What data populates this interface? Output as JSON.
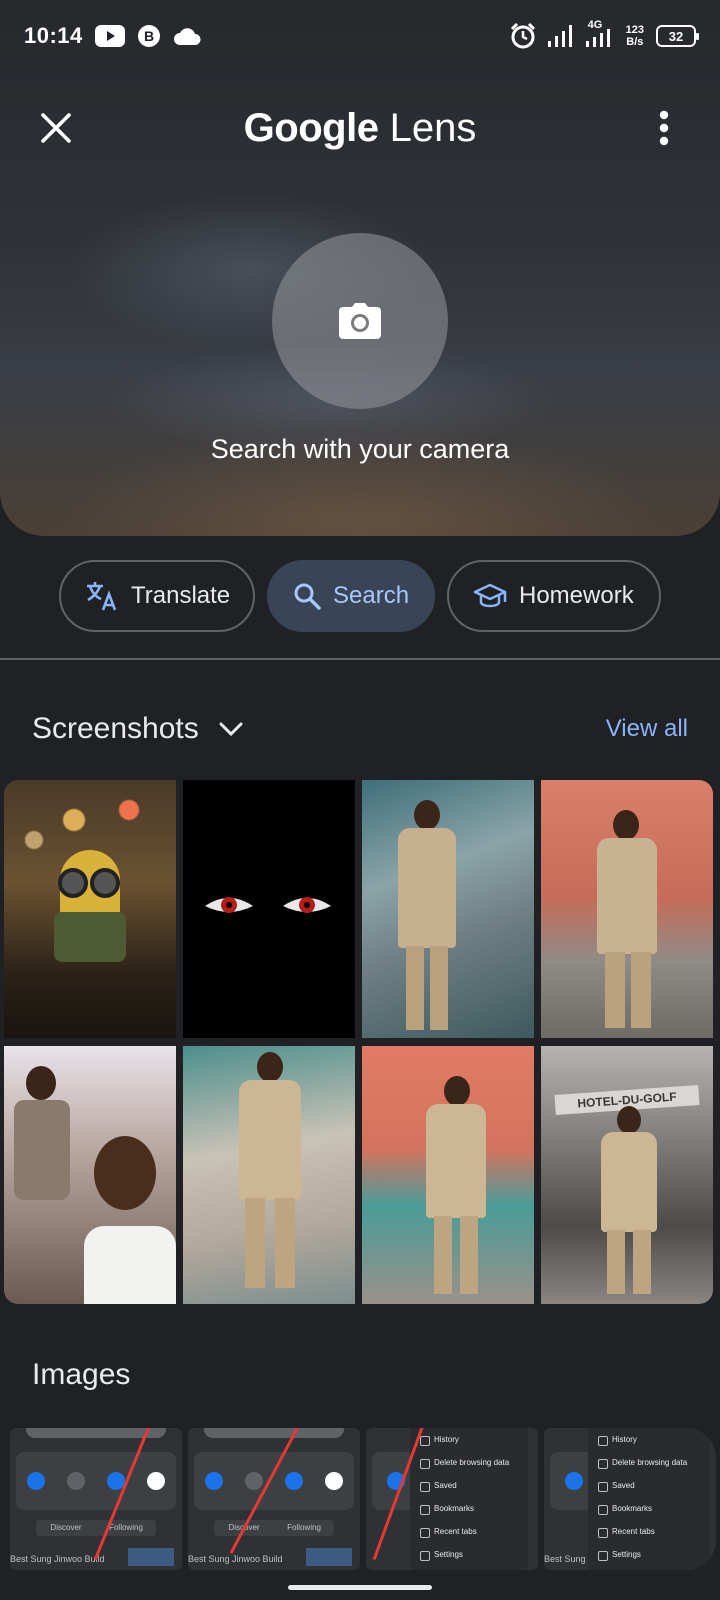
{
  "status_bar": {
    "time": "10:14",
    "left_icons": [
      "youtube-icon",
      "b-icon",
      "cloud-icon"
    ],
    "right_icons": [
      "alarm-icon",
      "signal-icon",
      "signal-4g-icon"
    ],
    "net_speed_value": "123",
    "net_speed_unit": "B/s",
    "network_type": "4G",
    "battery_level": "32"
  },
  "header": {
    "title_google": "Google",
    "title_lens": "Lens",
    "close_icon": "close-icon",
    "menu_icon": "more-vert-icon"
  },
  "camera": {
    "icon": "camera-icon",
    "label": "Search with your camera"
  },
  "modes": [
    {
      "label": "Translate",
      "icon": "translate-icon",
      "active": false
    },
    {
      "label": "Search",
      "icon": "search-icon",
      "active": true
    },
    {
      "label": "Homework",
      "icon": "school-icon",
      "active": false
    }
  ],
  "screenshots": {
    "title": "Screenshots",
    "view_all": "View all",
    "items": [
      {
        "type": "photo",
        "subject": "minion toy"
      },
      {
        "type": "photo",
        "subject": "red eyes in dark"
      },
      {
        "type": "photo",
        "subject": "person leaning on railing"
      },
      {
        "type": "photo",
        "subject": "person leaning on wall"
      },
      {
        "type": "photo",
        "subject": "selfie with peace sign"
      },
      {
        "type": "photo",
        "subject": "person standing"
      },
      {
        "type": "photo",
        "subject": "person standing by building"
      },
      {
        "type": "photo",
        "subject": "person at hotel gate"
      }
    ],
    "sign_text": "HOTEL-DU-GOLF"
  },
  "images": {
    "title": "Images",
    "items": [
      {
        "tabs": [
          "Discover",
          "Following"
        ],
        "caption": "Best Sung Jinwoo Build"
      },
      {
        "tabs": [
          "Discover",
          "Following"
        ],
        "caption": "Best Sung Jinwoo Build"
      },
      {
        "menu": [
          "History",
          "Delete browsing data",
          "Saved",
          "Bookmarks",
          "Recent tabs",
          "Settings"
        ]
      },
      {
        "menu": [
          "History",
          "Delete browsing data",
          "Saved",
          "Bookmarks",
          "Recent tabs",
          "Settings"
        ],
        "caption": "Best Sung Jinwoo Build"
      }
    ]
  },
  "colors": {
    "background": "#202124",
    "accent": "#8ab4f8",
    "active_chip": "#394457"
  }
}
